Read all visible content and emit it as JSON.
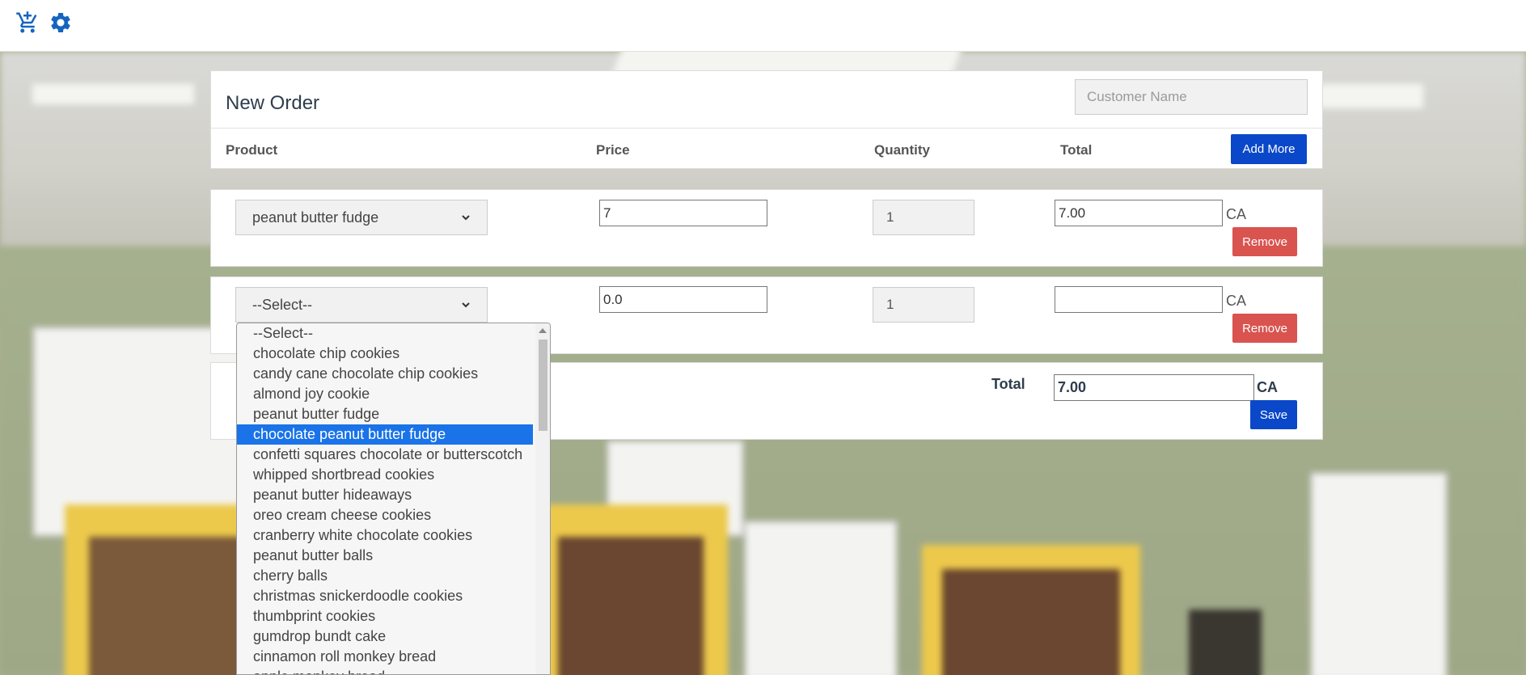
{
  "toolbar": {
    "cart_icon": "cart-plus-icon",
    "settings_icon": "gear-icon"
  },
  "order": {
    "title": "New Order",
    "customer_placeholder": "Customer Name",
    "columns": {
      "product": "Product",
      "price": "Price",
      "quantity": "Quantity",
      "total": "Total"
    },
    "add_more_label": "Add More",
    "rows": [
      {
        "product": "peanut butter fudge",
        "price": "7",
        "quantity": "1",
        "total": "7.00",
        "currency": "CA",
        "remove_label": "Remove"
      },
      {
        "product": "--Select--",
        "price": "0.0",
        "quantity": "1",
        "total": "",
        "currency": "CA",
        "remove_label": "Remove"
      }
    ],
    "grand_total_label": "Total",
    "grand_total": "7.00",
    "grand_currency": "CA",
    "save_label": "Save"
  },
  "dropdown": {
    "options": [
      "--Select--",
      "chocolate chip cookies",
      "candy cane chocolate chip cookies",
      "almond joy cookie",
      "peanut butter fudge",
      "chocolate peanut butter fudge",
      "confetti squares chocolate or butterscotch",
      "whipped shortbread cookies",
      "peanut butter hideaways",
      "oreo cream cheese cookies",
      "cranberry white chocolate cookies",
      "peanut butter balls",
      "cherry balls",
      "christmas snickerdoodle cookies",
      "thumbprint cookies",
      "gumdrop bundt cake",
      "cinnamon roll monkey bread",
      "apple monkey bread"
    ],
    "highlighted_index": 5
  },
  "colors": {
    "primary": "#0a48c9",
    "danger": "#d9534f",
    "highlight": "#1a73e8",
    "icon": "#1565c0"
  }
}
